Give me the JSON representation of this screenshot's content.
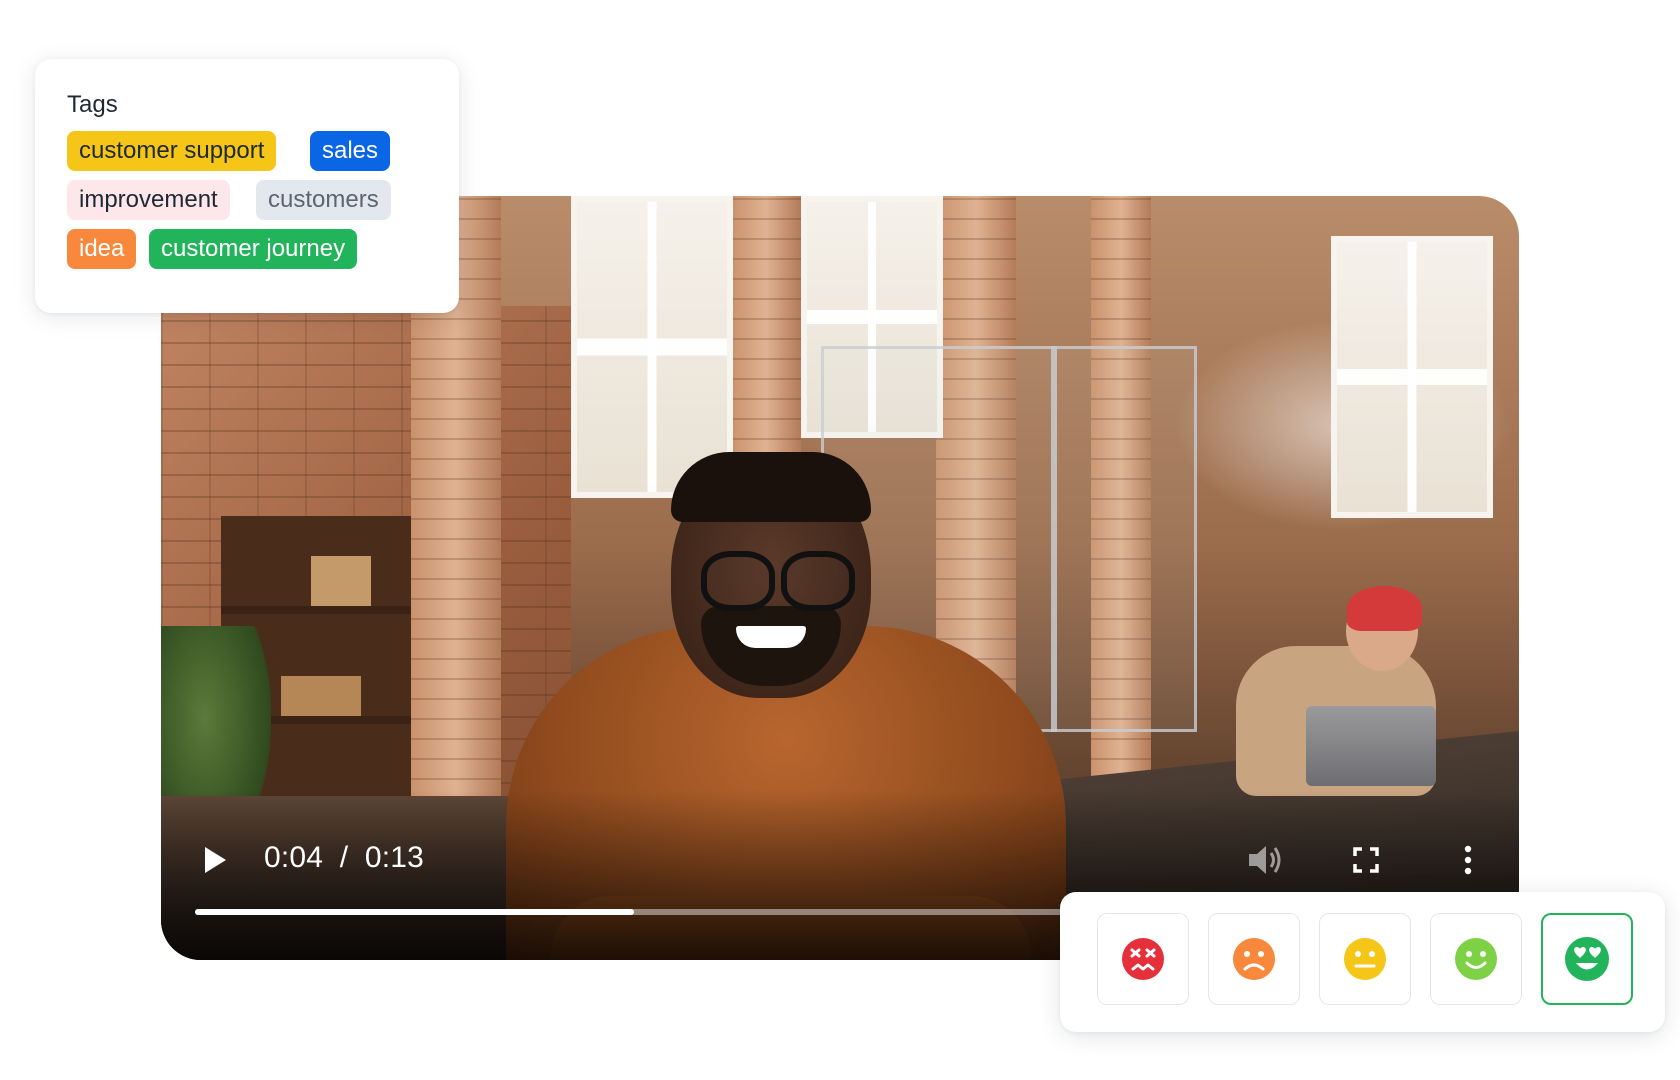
{
  "tags_card": {
    "title": "Tags",
    "tags": [
      {
        "label": "customer support",
        "bg": "#f5c518",
        "fg": "#1f2933"
      },
      {
        "label": "sales",
        "bg": "#0a66e4",
        "fg": "#ffffff"
      },
      {
        "label": "improvement",
        "bg": "#fde7ea",
        "fg": "#1f2933"
      },
      {
        "label": "customers",
        "bg": "#e3e8ee",
        "fg": "#5b6672"
      },
      {
        "label": "idea",
        "bg": "#f7883c",
        "fg": "#ffffff"
      },
      {
        "label": "customer journey",
        "bg": "#22b45a",
        "fg": "#ffffff"
      }
    ]
  },
  "video": {
    "current_time": "0:04",
    "separator": "/",
    "duration": "0:13",
    "progress_fraction": 0.34,
    "icons": {
      "play": "play-icon",
      "volume": "volume-icon",
      "fullscreen": "fullscreen-icon",
      "more": "more-vertical-icon"
    }
  },
  "rating": {
    "options": [
      {
        "name": "very-angry-face-icon",
        "color": "#e5303c",
        "selected": false
      },
      {
        "name": "frowning-face-icon",
        "color": "#f7883c",
        "selected": false
      },
      {
        "name": "neutral-face-icon",
        "color": "#f5c518",
        "selected": false
      },
      {
        "name": "smiling-face-icon",
        "color": "#7ed044",
        "selected": false
      },
      {
        "name": "heart-eyes-face-icon",
        "color": "#22b45a",
        "selected": true
      }
    ],
    "selected_border_color": "#22b45a"
  }
}
